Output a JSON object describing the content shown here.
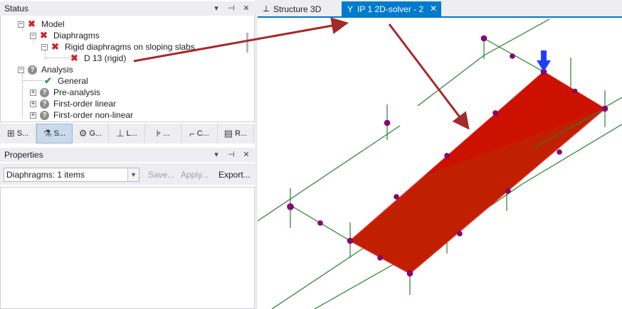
{
  "status_panel": {
    "title": "Status",
    "controls": [
      "▾",
      "⊣",
      "✕"
    ],
    "tree": [
      {
        "label": "Model",
        "state": "error",
        "expander": "−"
      },
      {
        "label": "Diaphragms",
        "state": "error",
        "expander": "−"
      },
      {
        "label": "Rigid diaphragms on sloping slabs",
        "state": "error",
        "expander": "−"
      },
      {
        "label": "D 13 (rigid)",
        "state": "error"
      },
      {
        "label": "Analysis",
        "state": "unknown",
        "expander": "−"
      },
      {
        "label": "General",
        "state": "ok"
      },
      {
        "label": "Pre-analysis",
        "state": "unknown",
        "expander": "+"
      },
      {
        "label": "First-order linear",
        "state": "unknown",
        "expander": "+"
      },
      {
        "label": "First-order non-linear",
        "state": "unknown",
        "expander": "+"
      }
    ]
  },
  "tool_tabs": [
    {
      "label": "S...",
      "icon": "structure-icon",
      "glyph": "⊞"
    },
    {
      "label": "S...",
      "icon": "status-icon",
      "glyph": "⚗",
      "active": true
    },
    {
      "label": "G...",
      "icon": "groups-icon",
      "glyph": "⚙"
    },
    {
      "label": "L...",
      "icon": "loads-icon",
      "glyph": "⊥"
    },
    {
      "label": "...",
      "icon": "results-icon",
      "glyph": "⊧"
    },
    {
      "label": "C...",
      "icon": "checks-icon",
      "glyph": "⌐"
    },
    {
      "label": "R...",
      "icon": "report-icon",
      "glyph": "▤"
    }
  ],
  "properties_panel": {
    "title": "Properties",
    "controls": [
      "▾",
      "⊣",
      "✕"
    ],
    "selection": "Diaphragms: 1 items",
    "save_label": "Save...",
    "apply_label": "Apply...",
    "export_label": "Export..."
  },
  "documents": {
    "tabs": [
      {
        "label": "Structure 3D",
        "icon": "structure-3d-icon"
      },
      {
        "label": "IP 1 2D-solver - 2",
        "icon": "solver-icon",
        "active": true
      }
    ],
    "close_glyph": "✕"
  },
  "colors": {
    "accent": "#007acc",
    "error": "#d0242a",
    "ok": "#2f9e3a",
    "slab": "#c02000",
    "beam": "#2e7d32",
    "node": "#8e0078",
    "annotation_arrow": "#a52a2a",
    "load_arrow": "#1f3fff"
  }
}
